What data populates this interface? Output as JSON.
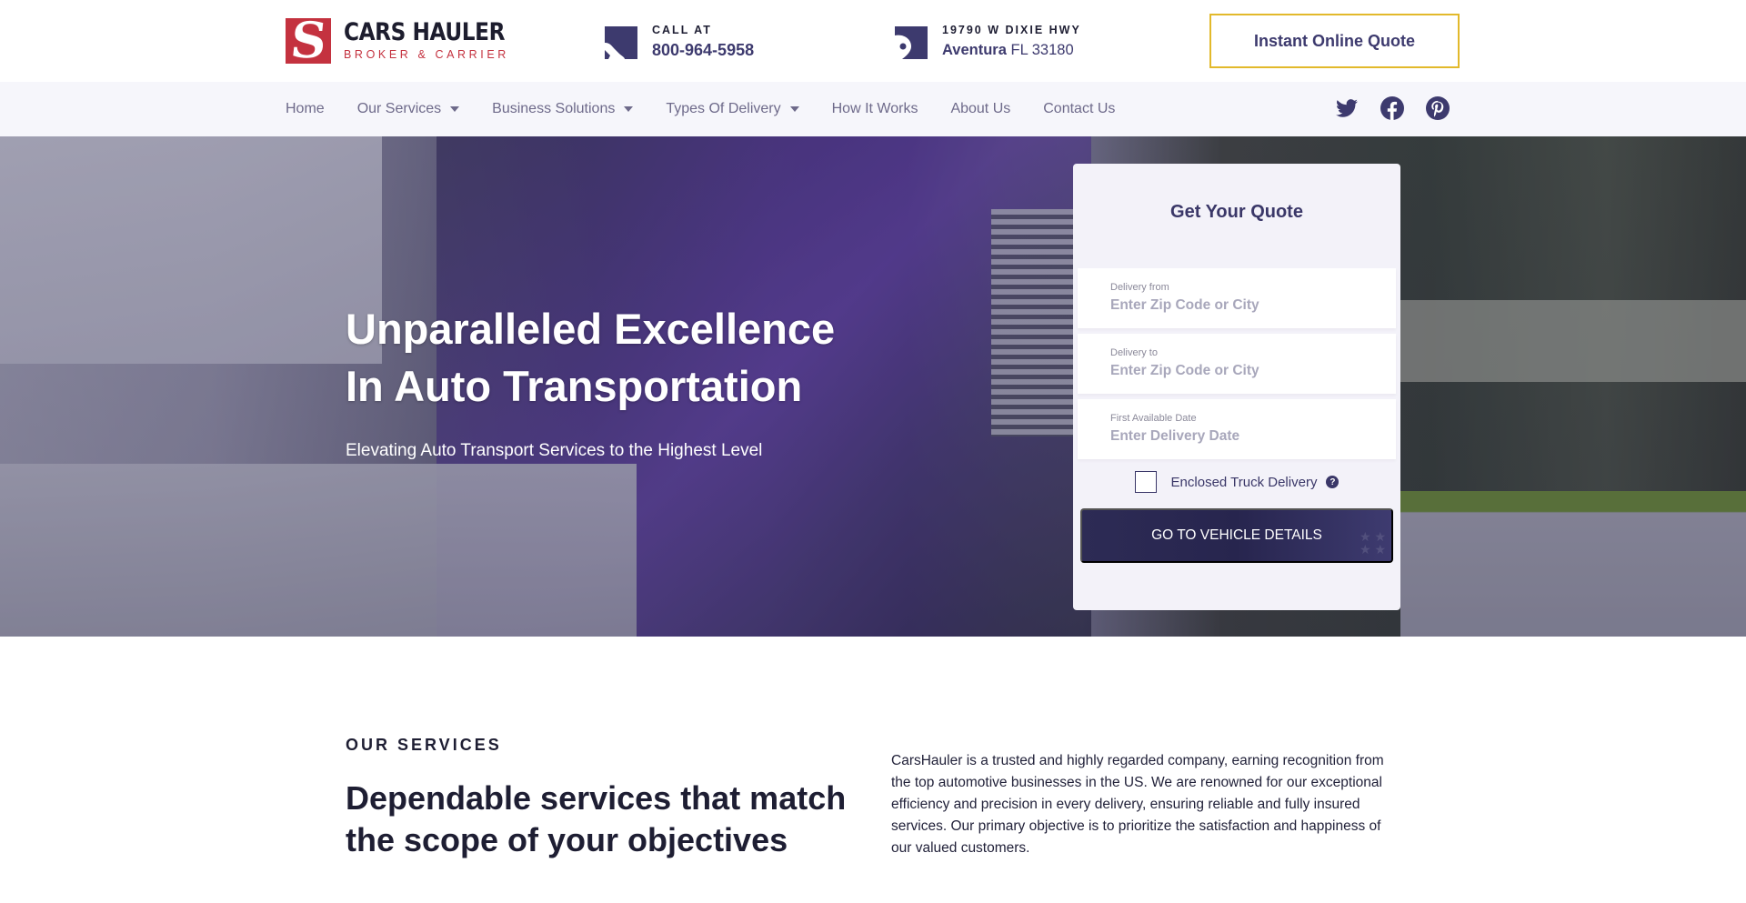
{
  "header": {
    "logo": {
      "title": "CARS HAULER",
      "subtitle": "BROKER & CARRIER",
      "mark": "S"
    },
    "phone": {
      "label": "CALL AT",
      "value": "800-964-5958",
      "icon": "phone-icon"
    },
    "address": {
      "label": "19790 W DIXIE HWY",
      "city": "Aventura",
      "state_zip": "FL 33180",
      "icon": "location-pin-icon"
    },
    "cta_label": "Instant Online Quote"
  },
  "nav": {
    "items": [
      {
        "label": "Home",
        "dropdown": false
      },
      {
        "label": "Our Services",
        "dropdown": true
      },
      {
        "label": "Business Solutions",
        "dropdown": true
      },
      {
        "label": "Types Of Delivery",
        "dropdown": true
      },
      {
        "label": "How It Works",
        "dropdown": false
      },
      {
        "label": "About Us",
        "dropdown": false
      },
      {
        "label": "Contact Us",
        "dropdown": false
      }
    ],
    "socials": [
      "twitter-icon",
      "facebook-icon",
      "pinterest-icon"
    ]
  },
  "hero": {
    "title_line1": "Unparalleled Excellence",
    "title_line2": "In Auto Transportation",
    "subtitle": "Elevating Auto Transport Services to the Highest Level"
  },
  "quote_form": {
    "title": "Get Your Quote",
    "fields": [
      {
        "label": "Delivery from",
        "value": "",
        "placeholder": "Enter Zip Code or City"
      },
      {
        "label": "Delivery to",
        "value": "",
        "placeholder": "Enter Zip Code or City"
      },
      {
        "label": "First Available Date",
        "value": "",
        "placeholder": "Enter Delivery Date"
      }
    ],
    "checkbox_label": "Enclosed Truck Delivery",
    "checkbox_checked": false,
    "help_glyph": "?",
    "submit_label": "GO TO VEHICLE DETAILS"
  },
  "services": {
    "kicker": "OUR SERVICES",
    "title": "Dependable services that match the scope of your objectives",
    "description": "CarsHauler is a trusted and highly regarded company, earning recognition from the top automotive businesses in the US. We are renowned for our exceptional efficiency and precision in every delivery, ensuring reliable and fully insured services. Our primary objective is to prioritize the satisfaction and happiness of our valued customers."
  },
  "colors": {
    "brand_navy": "#3d3a6e",
    "brand_red": "#c4323f",
    "cta_border": "#e2b92b",
    "button_dark": "#2d2b55"
  }
}
